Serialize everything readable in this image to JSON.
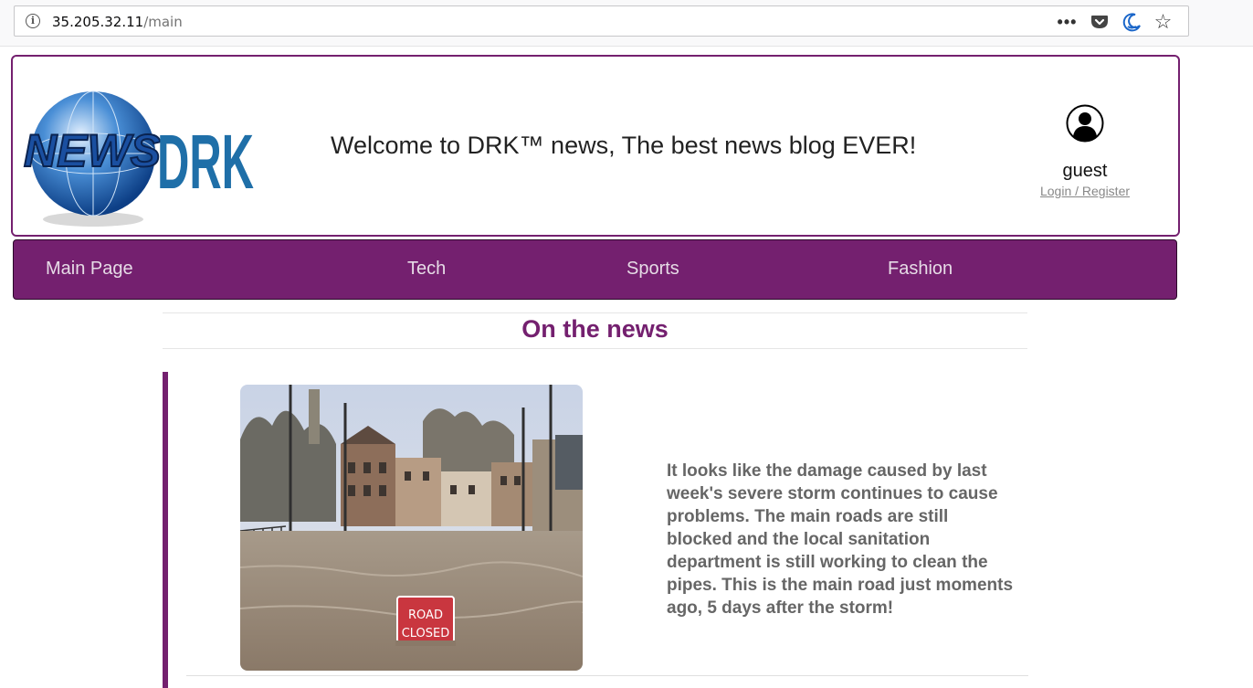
{
  "browser": {
    "url_host": "35.205.32.11",
    "url_path": "/main",
    "more_label": "•••",
    "bookmark_icon": "star-icon"
  },
  "header": {
    "logo_globe_text": "NEWS",
    "logo_brand_text": "DRK",
    "welcome": "Welcome to DRK™ news, The best news blog EVER!",
    "user": {
      "name": "guest",
      "login_label": "Login / Register",
      "avatar_icon": "user-avatar-icon"
    }
  },
  "nav": {
    "items": [
      {
        "label": "Main Page"
      },
      {
        "label": "Tech"
      },
      {
        "label": "Sports"
      },
      {
        "label": "Fashion"
      }
    ]
  },
  "main": {
    "section_title": "On the news",
    "article": {
      "image_sign_line1": "ROAD",
      "image_sign_line2": "CLOSED",
      "text": "It looks like the damage caused by last week's severe storm continues to cause problems. The main roads are still blocked and the local sanitation department is still working to clean the pipes. This is the main road just moments ago, 5 days after the storm!"
    }
  },
  "colors": {
    "brand_purple": "#74206f",
    "logo_blue": "#1f6fa8",
    "text_gray": "#666666"
  }
}
